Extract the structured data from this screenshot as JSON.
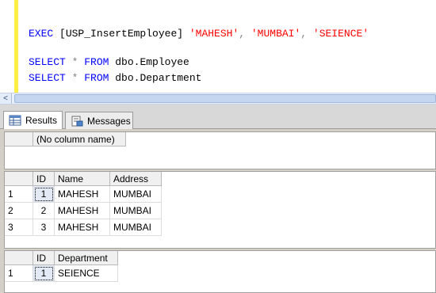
{
  "editor": {
    "lines": [
      {
        "tokens": [
          {
            "t": "EXEC ",
            "c": "kw"
          },
          {
            "t": "[USP_InsertEmployee] ",
            "c": "plain"
          },
          {
            "t": "'MAHESH'",
            "c": "str"
          },
          {
            "t": ", ",
            "c": "gray"
          },
          {
            "t": "'MUMBAI'",
            "c": "str"
          },
          {
            "t": ", ",
            "c": "gray"
          },
          {
            "t": "'SEIENCE'",
            "c": "str"
          }
        ]
      },
      {
        "tokens": [
          {
            "t": "SELECT ",
            "c": "kw"
          },
          {
            "t": "* ",
            "c": "gray"
          },
          {
            "t": "FROM ",
            "c": "kw"
          },
          {
            "t": "dbo.Employee",
            "c": "plain"
          }
        ]
      },
      {
        "tokens": [
          {
            "t": "SELECT ",
            "c": "kw"
          },
          {
            "t": "* ",
            "c": "gray"
          },
          {
            "t": "FROM ",
            "c": "kw"
          },
          {
            "t": "dbo.Department",
            "c": "plain"
          }
        ]
      }
    ]
  },
  "scroll": {
    "left_arrow": "<"
  },
  "tabs": [
    {
      "label": "Results",
      "icon": "results-grid-icon",
      "active": true
    },
    {
      "label": "Messages",
      "icon": "messages-icon",
      "active": false
    }
  ],
  "grids": [
    {
      "columns": [
        "(No column name)"
      ],
      "rows": []
    },
    {
      "columns": [
        "ID",
        "Name",
        "Address"
      ],
      "rows": [
        {
          "num": "1",
          "cells": [
            "1",
            "MAHESH",
            "MUMBAI"
          ]
        },
        {
          "num": "2",
          "cells": [
            "2",
            "MAHESH",
            "MUMBAI"
          ]
        },
        {
          "num": "3",
          "cells": [
            "3",
            "MAHESH",
            "MUMBAI"
          ]
        }
      ]
    },
    {
      "columns": [
        "ID",
        "Department"
      ],
      "rows": [
        {
          "num": "1",
          "cells": [
            "1",
            "SEIENCE"
          ]
        }
      ]
    }
  ],
  "colors": {
    "accent_yellow": "#ffee44",
    "keyword": "#0000ff",
    "string": "#ff0000"
  }
}
